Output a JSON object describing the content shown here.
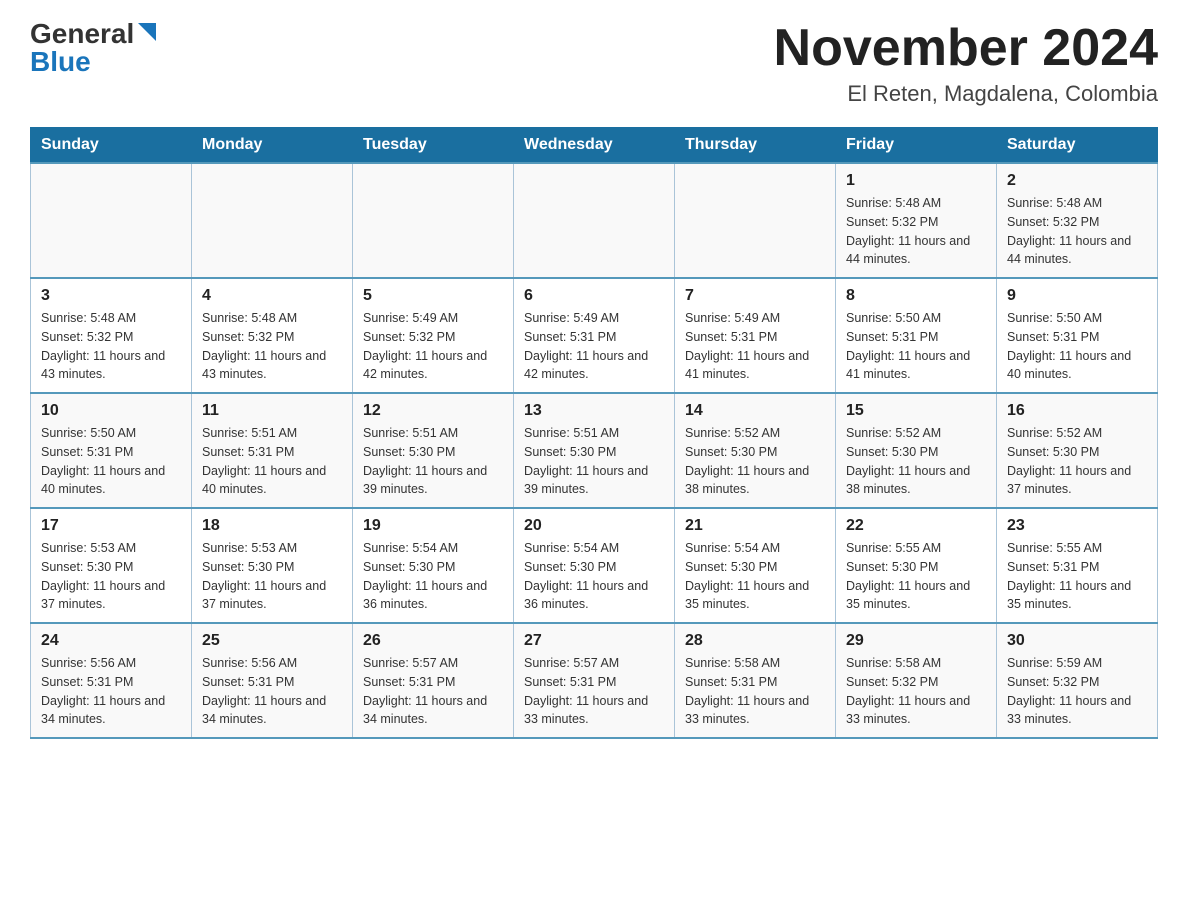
{
  "header": {
    "logo_general": "General",
    "logo_blue": "Blue",
    "month_title": "November 2024",
    "location": "El Reten, Magdalena, Colombia"
  },
  "calendar": {
    "days_of_week": [
      "Sunday",
      "Monday",
      "Tuesday",
      "Wednesday",
      "Thursday",
      "Friday",
      "Saturday"
    ],
    "weeks": [
      [
        {
          "day": "",
          "sunrise": "",
          "sunset": "",
          "daylight": ""
        },
        {
          "day": "",
          "sunrise": "",
          "sunset": "",
          "daylight": ""
        },
        {
          "day": "",
          "sunrise": "",
          "sunset": "",
          "daylight": ""
        },
        {
          "day": "",
          "sunrise": "",
          "sunset": "",
          "daylight": ""
        },
        {
          "day": "",
          "sunrise": "",
          "sunset": "",
          "daylight": ""
        },
        {
          "day": "1",
          "sunrise": "Sunrise: 5:48 AM",
          "sunset": "Sunset: 5:32 PM",
          "daylight": "Daylight: 11 hours and 44 minutes."
        },
        {
          "day": "2",
          "sunrise": "Sunrise: 5:48 AM",
          "sunset": "Sunset: 5:32 PM",
          "daylight": "Daylight: 11 hours and 44 minutes."
        }
      ],
      [
        {
          "day": "3",
          "sunrise": "Sunrise: 5:48 AM",
          "sunset": "Sunset: 5:32 PM",
          "daylight": "Daylight: 11 hours and 43 minutes."
        },
        {
          "day": "4",
          "sunrise": "Sunrise: 5:48 AM",
          "sunset": "Sunset: 5:32 PM",
          "daylight": "Daylight: 11 hours and 43 minutes."
        },
        {
          "day": "5",
          "sunrise": "Sunrise: 5:49 AM",
          "sunset": "Sunset: 5:32 PM",
          "daylight": "Daylight: 11 hours and 42 minutes."
        },
        {
          "day": "6",
          "sunrise": "Sunrise: 5:49 AM",
          "sunset": "Sunset: 5:31 PM",
          "daylight": "Daylight: 11 hours and 42 minutes."
        },
        {
          "day": "7",
          "sunrise": "Sunrise: 5:49 AM",
          "sunset": "Sunset: 5:31 PM",
          "daylight": "Daylight: 11 hours and 41 minutes."
        },
        {
          "day": "8",
          "sunrise": "Sunrise: 5:50 AM",
          "sunset": "Sunset: 5:31 PM",
          "daylight": "Daylight: 11 hours and 41 minutes."
        },
        {
          "day": "9",
          "sunrise": "Sunrise: 5:50 AM",
          "sunset": "Sunset: 5:31 PM",
          "daylight": "Daylight: 11 hours and 40 minutes."
        }
      ],
      [
        {
          "day": "10",
          "sunrise": "Sunrise: 5:50 AM",
          "sunset": "Sunset: 5:31 PM",
          "daylight": "Daylight: 11 hours and 40 minutes."
        },
        {
          "day": "11",
          "sunrise": "Sunrise: 5:51 AM",
          "sunset": "Sunset: 5:31 PM",
          "daylight": "Daylight: 11 hours and 40 minutes."
        },
        {
          "day": "12",
          "sunrise": "Sunrise: 5:51 AM",
          "sunset": "Sunset: 5:30 PM",
          "daylight": "Daylight: 11 hours and 39 minutes."
        },
        {
          "day": "13",
          "sunrise": "Sunrise: 5:51 AM",
          "sunset": "Sunset: 5:30 PM",
          "daylight": "Daylight: 11 hours and 39 minutes."
        },
        {
          "day": "14",
          "sunrise": "Sunrise: 5:52 AM",
          "sunset": "Sunset: 5:30 PM",
          "daylight": "Daylight: 11 hours and 38 minutes."
        },
        {
          "day": "15",
          "sunrise": "Sunrise: 5:52 AM",
          "sunset": "Sunset: 5:30 PM",
          "daylight": "Daylight: 11 hours and 38 minutes."
        },
        {
          "day": "16",
          "sunrise": "Sunrise: 5:52 AM",
          "sunset": "Sunset: 5:30 PM",
          "daylight": "Daylight: 11 hours and 37 minutes."
        }
      ],
      [
        {
          "day": "17",
          "sunrise": "Sunrise: 5:53 AM",
          "sunset": "Sunset: 5:30 PM",
          "daylight": "Daylight: 11 hours and 37 minutes."
        },
        {
          "day": "18",
          "sunrise": "Sunrise: 5:53 AM",
          "sunset": "Sunset: 5:30 PM",
          "daylight": "Daylight: 11 hours and 37 minutes."
        },
        {
          "day": "19",
          "sunrise": "Sunrise: 5:54 AM",
          "sunset": "Sunset: 5:30 PM",
          "daylight": "Daylight: 11 hours and 36 minutes."
        },
        {
          "day": "20",
          "sunrise": "Sunrise: 5:54 AM",
          "sunset": "Sunset: 5:30 PM",
          "daylight": "Daylight: 11 hours and 36 minutes."
        },
        {
          "day": "21",
          "sunrise": "Sunrise: 5:54 AM",
          "sunset": "Sunset: 5:30 PM",
          "daylight": "Daylight: 11 hours and 35 minutes."
        },
        {
          "day": "22",
          "sunrise": "Sunrise: 5:55 AM",
          "sunset": "Sunset: 5:30 PM",
          "daylight": "Daylight: 11 hours and 35 minutes."
        },
        {
          "day": "23",
          "sunrise": "Sunrise: 5:55 AM",
          "sunset": "Sunset: 5:31 PM",
          "daylight": "Daylight: 11 hours and 35 minutes."
        }
      ],
      [
        {
          "day": "24",
          "sunrise": "Sunrise: 5:56 AM",
          "sunset": "Sunset: 5:31 PM",
          "daylight": "Daylight: 11 hours and 34 minutes."
        },
        {
          "day": "25",
          "sunrise": "Sunrise: 5:56 AM",
          "sunset": "Sunset: 5:31 PM",
          "daylight": "Daylight: 11 hours and 34 minutes."
        },
        {
          "day": "26",
          "sunrise": "Sunrise: 5:57 AM",
          "sunset": "Sunset: 5:31 PM",
          "daylight": "Daylight: 11 hours and 34 minutes."
        },
        {
          "day": "27",
          "sunrise": "Sunrise: 5:57 AM",
          "sunset": "Sunset: 5:31 PM",
          "daylight": "Daylight: 11 hours and 33 minutes."
        },
        {
          "day": "28",
          "sunrise": "Sunrise: 5:58 AM",
          "sunset": "Sunset: 5:31 PM",
          "daylight": "Daylight: 11 hours and 33 minutes."
        },
        {
          "day": "29",
          "sunrise": "Sunrise: 5:58 AM",
          "sunset": "Sunset: 5:32 PM",
          "daylight": "Daylight: 11 hours and 33 minutes."
        },
        {
          "day": "30",
          "sunrise": "Sunrise: 5:59 AM",
          "sunset": "Sunset: 5:32 PM",
          "daylight": "Daylight: 11 hours and 33 minutes."
        }
      ]
    ]
  }
}
